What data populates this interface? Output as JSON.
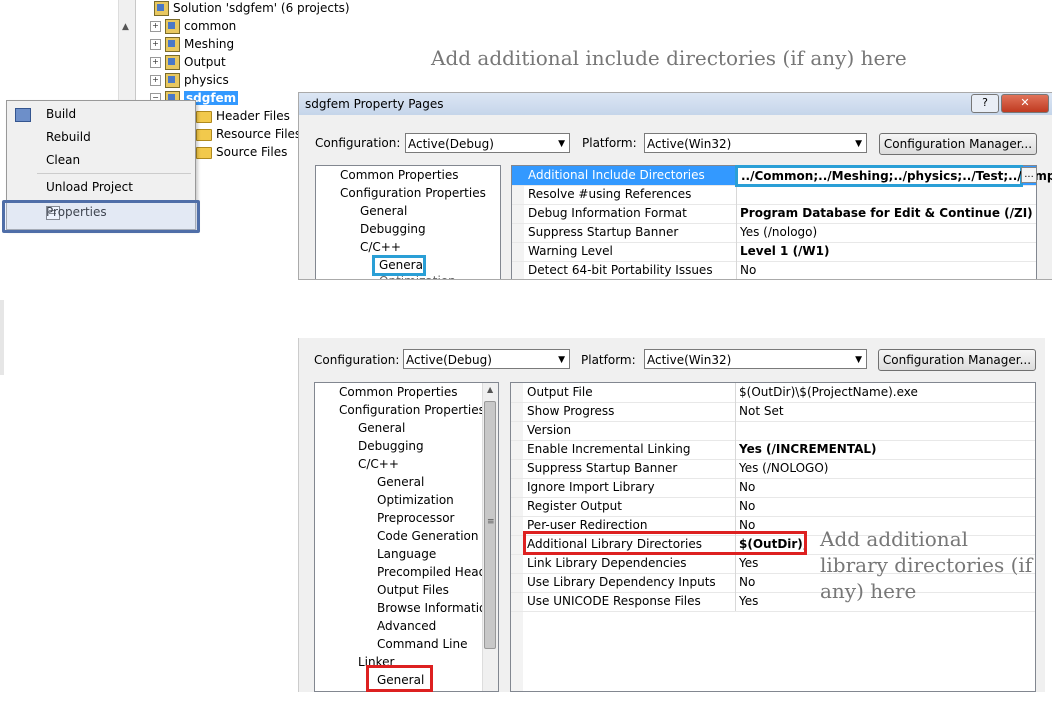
{
  "solution": {
    "title": "Solution 'sdgfem' (6 projects)",
    "projects": [
      "common",
      "Meshing",
      "Output",
      "physics",
      "sdgfem"
    ],
    "selected_project": "sdgfem",
    "folders": [
      "Header Files",
      "Resource Files",
      "Source Files"
    ]
  },
  "context_menu": {
    "items": [
      "Build",
      "Rebuild",
      "Clean",
      "Unload Project",
      "Properties"
    ]
  },
  "annotations": {
    "include_dirs": "Add additional include directories (if any) here",
    "library_dirs_lines": [
      "Add additional",
      "library directories (if",
      "any) here"
    ]
  },
  "dialog_top": {
    "title": "sdgfem Property Pages",
    "help_btn": "?",
    "close_btn": "✕",
    "configuration_label": "Configuration:",
    "configuration_value": "Active(Debug)",
    "platform_label": "Platform:",
    "platform_value": "Active(Win32)",
    "config_manager_btn": "Configuration Manager...",
    "tree": [
      "Common Properties",
      "Configuration Properties",
      "General",
      "Debugging",
      "C/C++",
      "General"
    ],
    "tree_cut": "Optimization",
    "rows": [
      {
        "name": "Additional Include Directories",
        "value": "../Common;../Meshing;../physics;../Test;../Simplex",
        "bold": true
      },
      {
        "name": "Resolve #using References",
        "value": "",
        "bold": false
      },
      {
        "name": "Debug Information Format",
        "value": "Program Database for Edit & Continue (/ZI)",
        "bold": true
      },
      {
        "name": "Suppress Startup Banner",
        "value": "Yes (/nologo)",
        "bold": false
      },
      {
        "name": "Warning Level",
        "value": "Level 1 (/W1)",
        "bold": true
      },
      {
        "name": "Detect 64-bit Portability Issues",
        "value": "No",
        "bold": false
      }
    ],
    "ellipsis": "..."
  },
  "dialog_bottom": {
    "configuration_label": "Configuration:",
    "configuration_value": "Active(Debug)",
    "platform_label": "Platform:",
    "platform_value": "Active(Win32)",
    "config_manager_btn": "Configuration Manager...",
    "tree": [
      "Common Properties",
      "Configuration Properties",
      "General",
      "Debugging",
      "C/C++",
      "General",
      "Optimization",
      "Preprocessor",
      "Code Generation",
      "Language",
      "Precompiled Heade",
      "Output Files",
      "Browse Information",
      "Advanced",
      "Command Line",
      "Linker",
      "General"
    ],
    "rows": [
      {
        "name": "Output File",
        "value": "$(OutDir)\\$(ProjectName).exe",
        "bold": false
      },
      {
        "name": "Show Progress",
        "value": "Not Set",
        "bold": false
      },
      {
        "name": "Version",
        "value": "",
        "bold": false
      },
      {
        "name": "Enable Incremental Linking",
        "value": "Yes (/INCREMENTAL)",
        "bold": true
      },
      {
        "name": "Suppress Startup Banner",
        "value": "Yes (/NOLOGO)",
        "bold": false
      },
      {
        "name": "Ignore Import Library",
        "value": "No",
        "bold": false
      },
      {
        "name": "Register Output",
        "value": "No",
        "bold": false
      },
      {
        "name": "Per-user Redirection",
        "value": "No",
        "bold": false
      },
      {
        "name": "Additional Library Directories",
        "value": "$(OutDir);",
        "bold": true
      },
      {
        "name": "Link Library Dependencies",
        "value": "Yes",
        "bold": false
      },
      {
        "name": "Use Library Dependency Inputs",
        "value": "No",
        "bold": false
      },
      {
        "name": "Use UNICODE Response Files",
        "value": "Yes",
        "bold": false
      }
    ]
  },
  "colors": {
    "highlight_blue": "#2a9fd6",
    "highlight_red": "#dd2020",
    "selection": "#3399ff"
  }
}
